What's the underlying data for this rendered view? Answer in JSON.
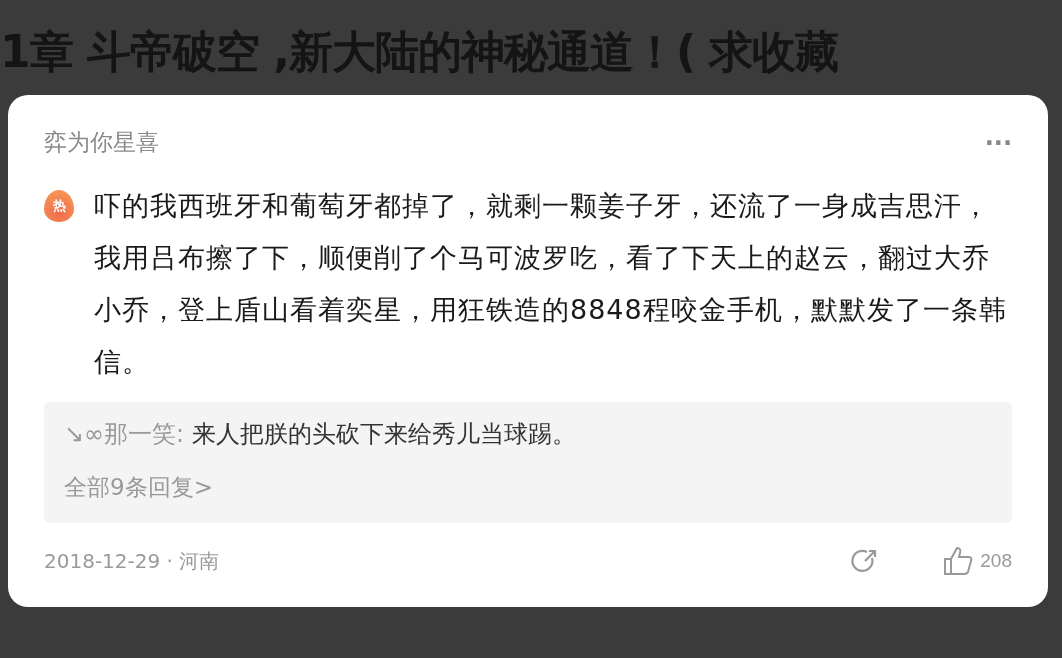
{
  "page_heading": "1章 斗帝破空 ,新大陆的神秘通道！( 求收藏",
  "comment": {
    "author": "弈为你星喜",
    "more": "···",
    "hot_badge": "热",
    "text": "吓的我西班牙和葡萄牙都掉了，就剩一颗姜子牙，还流了一身成吉思汗，我用吕布擦了下，顺便削了个马可波罗吃，看了下天上的赵云，翻过大乔小乔，登上盾山看着奕星，用狂铁造的8848程咬金手机，默默发了一条韩信。",
    "reply": {
      "author": "↘∞那一笑:",
      "text": "来人把朕的头砍下来给秀儿当球踢。"
    },
    "all_replies": "全部9条回复>",
    "meta": "2018-12-29 · 河南",
    "likes": "208"
  }
}
